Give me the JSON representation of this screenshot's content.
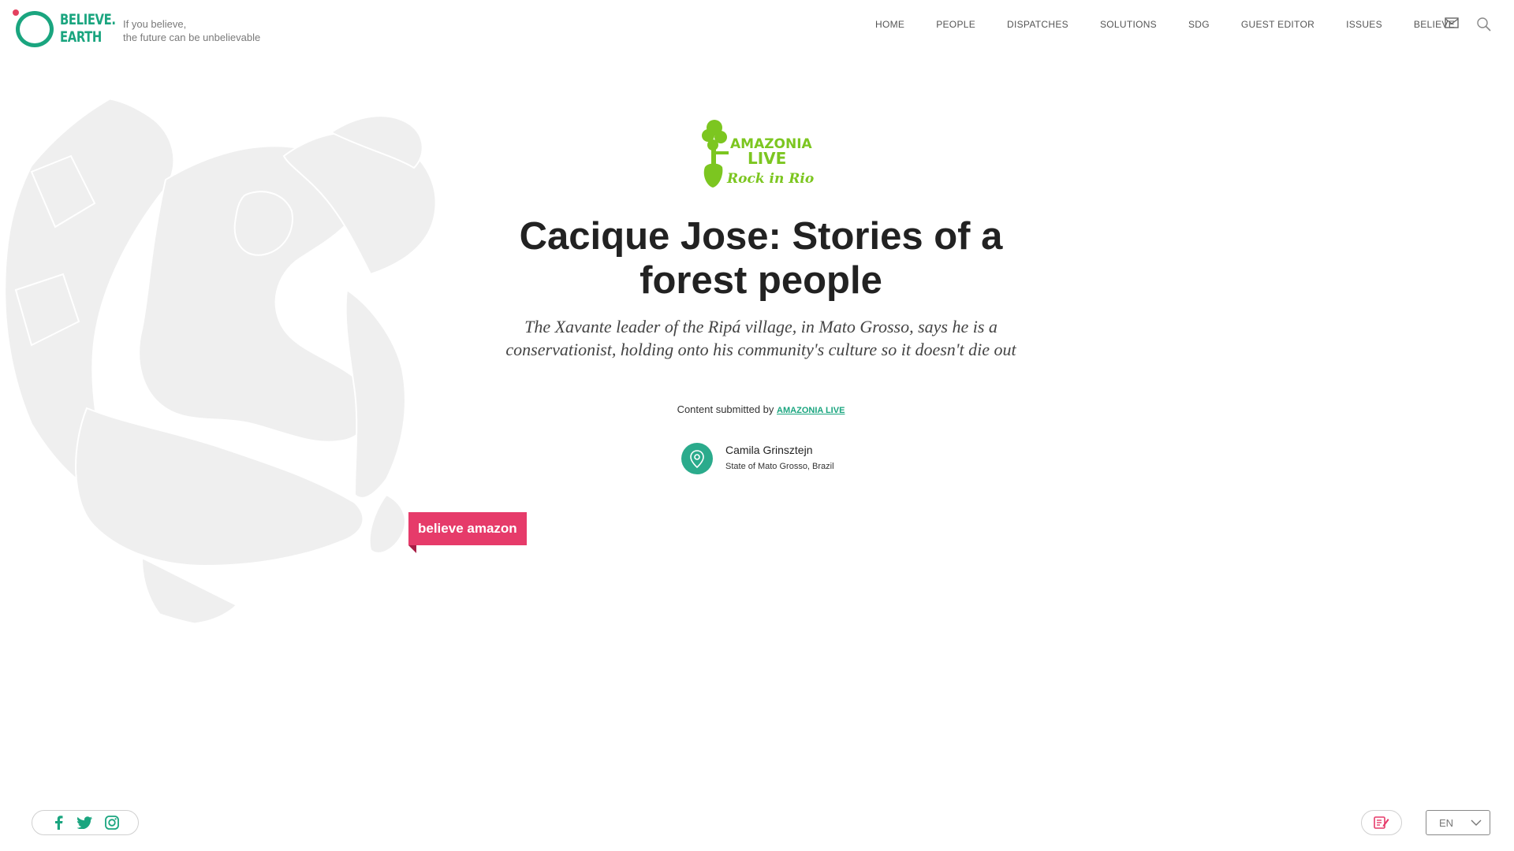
{
  "brand": {
    "logo_line1": "BELIEVE.",
    "logo_line2": "EARTH",
    "tagline_line1": "If you believe,",
    "tagline_line2": "the future can be unbelievable",
    "color": "#1aa57f"
  },
  "nav": {
    "items": [
      "HOME",
      "PEOPLE",
      "DISPATCHES",
      "SOLUTIONS",
      "SDG",
      "GUEST EDITOR",
      "ISSUES",
      "BELIEVE"
    ],
    "icons": [
      "mail-icon",
      "search-icon"
    ]
  },
  "partner": {
    "line1": "AMAZONIA",
    "line2": "LIVE",
    "line3": "Rock in Rio",
    "color": "#7cc620"
  },
  "article": {
    "title": "Cacique Jose: Stories of a forest people",
    "subtitle": "The Xavante leader of the Ripá village, in Mato Grosso, says he is a conservationist, holding onto his community's culture so it doesn't die out",
    "submitted_label": "Content submitted by",
    "submitted_by": "AMAZONIA LIVE",
    "author": "Camila Grinsztejn",
    "place": "State of Mato Grosso, Brazil"
  },
  "ribbon": {
    "label": "believe amazon",
    "color": "#e63b6a"
  },
  "footer": {
    "social": [
      "facebook-icon",
      "twitter-icon",
      "instagram-icon"
    ],
    "language": "EN"
  }
}
